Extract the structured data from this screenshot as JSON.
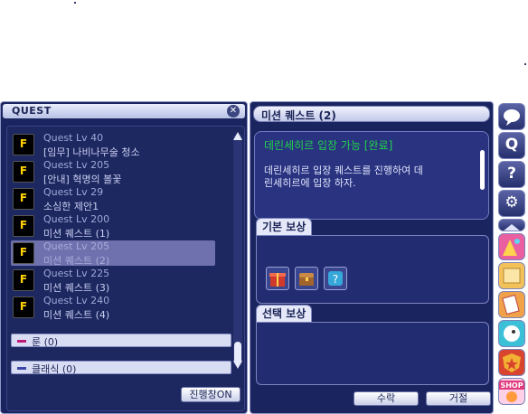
{
  "quest_window": {
    "title": "QUEST",
    "items": [
      {
        "level": "Quest Lv 40",
        "name": "[임무] 나비나무술 청소",
        "icon": "F"
      },
      {
        "level": "Quest Lv 205",
        "name": "[안내] 혁명의 볼꽃",
        "icon": "F"
      },
      {
        "level": "Quest Lv 29",
        "name": "소심한 제안1",
        "icon": "F"
      },
      {
        "level": "Quest Lv 200",
        "name": "미션 퀘스트 (1)",
        "icon": "F"
      },
      {
        "level": "Quest Lv 205",
        "name": "미션 퀘스트 (2)",
        "icon": "F"
      },
      {
        "level": "Quest Lv 225",
        "name": "미션 퀘스트 (3)",
        "icon": "F"
      },
      {
        "level": "Quest Lv 240",
        "name": "미션 퀘스트 (4)",
        "icon": "F"
      }
    ],
    "selected_index": 4,
    "categories": [
      {
        "label": "룬 (0)",
        "color": "#c2187a"
      },
      {
        "label": "클래식 (0)",
        "color": "#3b47a8"
      }
    ],
    "progress_button": "진행창ON"
  },
  "detail_window": {
    "title": "미션 퀘스트 (2)",
    "heading": "데린세히르 입장 가능 [완료]",
    "description": [
      "데린세히르 입장 퀘스트를 진행하여 데",
      "린세히르에 입장 하자."
    ],
    "basic_reward_label": "기본 보상",
    "basic_rewards": [
      "gift-box-icon",
      "treasure-chest-icon",
      "mystery-box-icon"
    ],
    "select_reward_label": "선택 보상",
    "accept_button": "수락",
    "decline_button": "거절"
  },
  "side_toolbar": {
    "buttons": [
      "chat-bubble-icon",
      "search-icon",
      "help-icon",
      "settings-icon",
      "collapse-icon",
      "party-icon",
      "scroll-icon",
      "card-icon",
      "bird-icon",
      "shield-star-icon",
      "shop-icon"
    ],
    "shop_label": "SHOP"
  },
  "colors": {
    "window_bg": "#1a245e",
    "heading_green": "#22d34a",
    "icon_yellow": "#ffd200"
  }
}
